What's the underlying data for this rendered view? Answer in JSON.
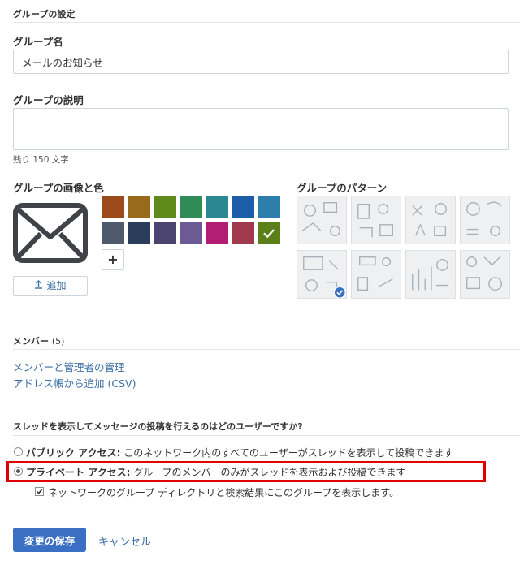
{
  "page": {
    "section_title": "グループの設定",
    "group_name_label": "グループ名",
    "group_name_value": "メールのお知らせ",
    "description_label": "グループの説明",
    "description_value": "",
    "chars_remaining": "残り 150 文字",
    "image_color_label": "グループの画像と色",
    "add_button": "追加",
    "add_color_symbol": "+",
    "pattern_label": "グループのパターン"
  },
  "colors": {
    "swatches": [
      "#9c4a1b",
      "#9a6a1c",
      "#5f8a1c",
      "#2f8c56",
      "#2b8792",
      "#1c5ea8",
      "#2d7eab",
      "#4f5a6c",
      "#2a3d5a",
      "#4b4471",
      "#6d5993",
      "#b31e75",
      "#a13a4d",
      "#5b8019"
    ],
    "selected_index": 13,
    "accent": "#3a6fc4",
    "highlight_border": "#e00000"
  },
  "members": {
    "title": "メンバー",
    "count": "(5)",
    "manage_link": "メンバーと管理者の管理",
    "csv_link": "アドレス帳から追加 (CSV)"
  },
  "access": {
    "question": "スレッドを表示してメッセージの投稿を行えるのはどのユーザーですか?",
    "public_bold": "パブリック アクセス:",
    "public_text": " このネットワーク内のすべてのユーザーがスレッドを表示して投稿できます",
    "private_bold": "プライベート アクセス:",
    "private_text": " グループのメンバーのみがスレッドを表示および投稿できます",
    "directory_checkbox": "ネットワークのグループ ディレクトリと検索結果にこのグループを表示します。",
    "selected": "private"
  },
  "actions": {
    "save": "変更の保存",
    "cancel": "キャンセル"
  }
}
